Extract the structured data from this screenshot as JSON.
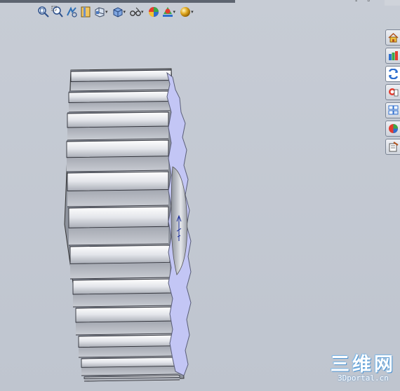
{
  "hud": {
    "tools": [
      {
        "icon": "zoom-to-fit-icon",
        "dropdown": false
      },
      {
        "icon": "zoom-to-area-icon",
        "dropdown": false
      },
      {
        "icon": "previous-view-icon",
        "dropdown": false
      },
      {
        "icon": "section-view-icon",
        "dropdown": false
      },
      {
        "icon": "view-orientation-icon",
        "dropdown": true
      },
      {
        "icon": "display-style-icon",
        "dropdown": true
      },
      {
        "icon": "hide-show-items-icon",
        "dropdown": true
      },
      {
        "icon": "edit-appearance-icon",
        "dropdown": false
      },
      {
        "icon": "apply-scene-icon",
        "dropdown": true
      },
      {
        "icon": "view-settings-icon",
        "dropdown": true
      }
    ],
    "dropdown_glyph": "▾"
  },
  "task_pane": {
    "tabs": [
      {
        "icon": "solidworks-resources-icon",
        "active": false
      },
      {
        "icon": "design-library-icon",
        "active": false
      },
      {
        "icon": "file-explorer-icon",
        "active": true
      },
      {
        "icon": "search-icon",
        "active": false
      },
      {
        "icon": "view-palette-icon",
        "active": false
      },
      {
        "icon": "appearances-scenes-icon",
        "active": false
      },
      {
        "icon": "custom-properties-icon",
        "active": false
      }
    ]
  },
  "model": {
    "name": "spur-gear",
    "colors": {
      "teeth": "#d9dce1",
      "face": "#c3c6f5",
      "background": "#c4c9d2"
    }
  },
  "watermark": {
    "cn": "三维网",
    "en": "3Dportal.cn"
  }
}
